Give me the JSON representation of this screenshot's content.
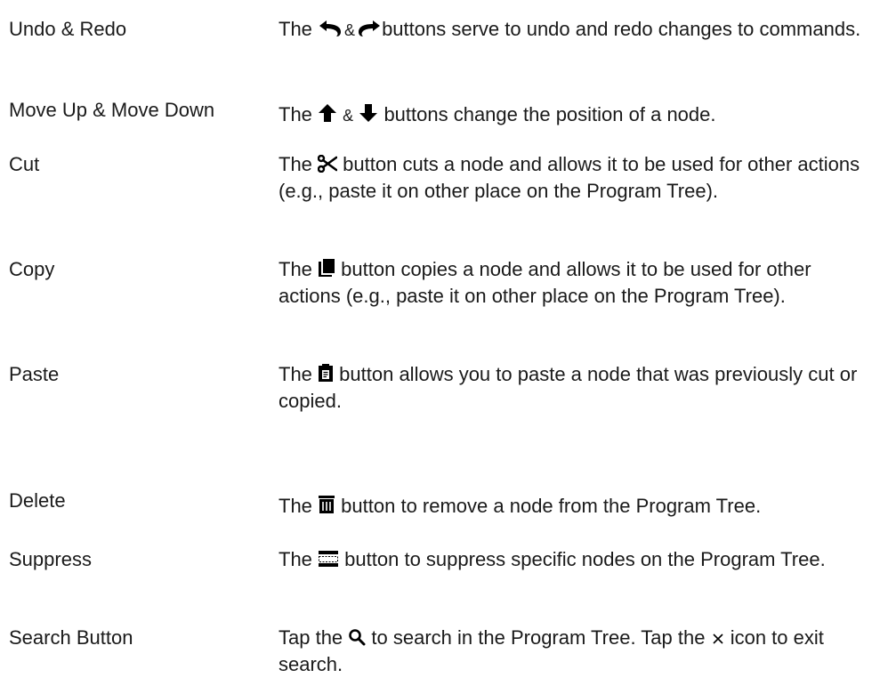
{
  "rows": [
    {
      "term": "Undo & Redo",
      "parts": [
        "The",
        "&",
        "buttons serve to undo and redo changes to commands."
      ],
      "icons": [
        "undo-arrow-icon",
        "redo-arrow-icon"
      ]
    },
    {
      "term": "Move Up & Move Down",
      "parts": [
        "The",
        "&",
        "buttons change the position of a node."
      ],
      "icons": [
        "arrow-up-icon",
        "arrow-down-icon"
      ]
    },
    {
      "term": "Cut",
      "parts": [
        "The",
        "button cuts a node and allows it to be used for other actions (e.g., paste it on other place on the Program Tree)."
      ],
      "icons": [
        "scissors-icon"
      ]
    },
    {
      "term": "Copy",
      "parts": [
        "The",
        "button copies a node and allows it to be used for other actions (e.g., paste it on other place on the Program Tree)."
      ],
      "icons": [
        "copy-icon"
      ]
    },
    {
      "term": "Paste",
      "parts": [
        "The",
        "button allows you to paste a node that was previously cut or copied."
      ],
      "icons": [
        "clipboard-paste-icon"
      ]
    },
    {
      "term": "Delete",
      "parts": [
        "The",
        "button to remove a node from the Program Tree."
      ],
      "icons": [
        "trash-icon"
      ]
    },
    {
      "term": "Suppress",
      "parts": [
        "The",
        "button to suppress specific nodes on the Program Tree."
      ],
      "icons": [
        "suppress-icon"
      ]
    },
    {
      "term": "Search Button",
      "parts": [
        "Tap the",
        "to search in the Program Tree. Tap the",
        "icon to exit search."
      ],
      "icons": [
        "search-icon",
        "close-x-icon"
      ]
    }
  ]
}
